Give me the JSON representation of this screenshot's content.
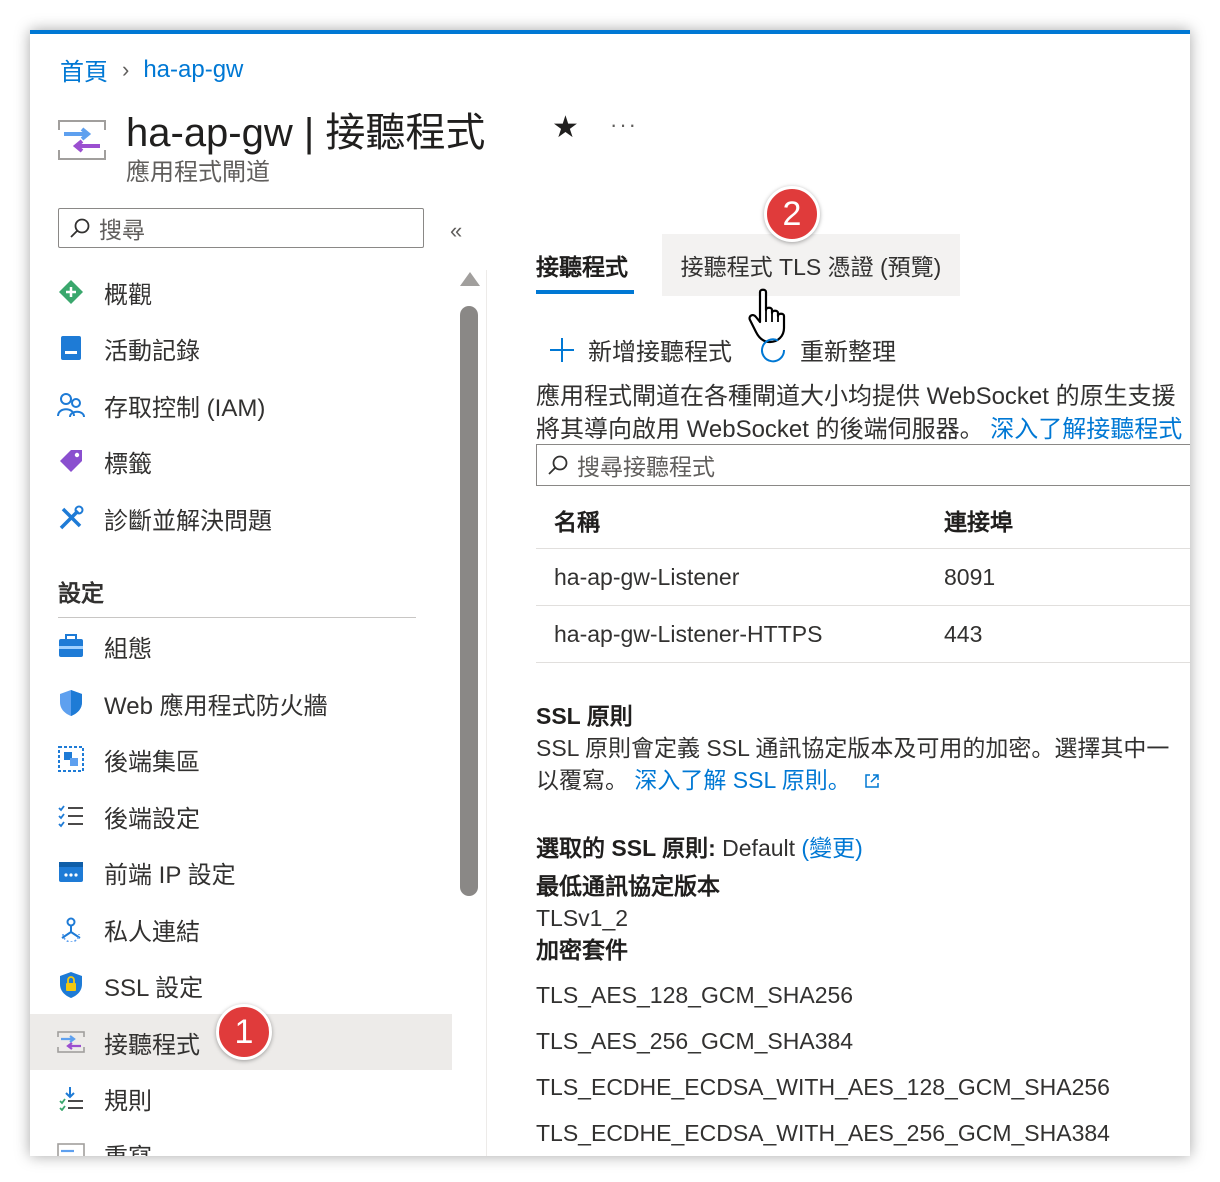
{
  "breadcrumb": {
    "home": "首頁",
    "separator": "›",
    "current": "ha-ap-gw"
  },
  "header": {
    "title": "ha-ap-gw | 接聽程式",
    "subtitle": "應用程式閘道",
    "favorite_glyph": "★",
    "more_glyph": "···",
    "icon": "application-gateway-icon"
  },
  "sidebar": {
    "search_placeholder": "搜尋",
    "collapse_glyph": "«",
    "items": [
      {
        "label": "概觀",
        "icon": "overview-icon"
      },
      {
        "label": "活動記錄",
        "icon": "activity-log-icon"
      },
      {
        "label": "存取控制 (IAM)",
        "icon": "iam-icon"
      },
      {
        "label": "標籤",
        "icon": "tag-icon"
      },
      {
        "label": "診斷並解決問題",
        "icon": "diagnose-icon"
      }
    ],
    "section": "設定",
    "settings_items": [
      {
        "label": "組態",
        "icon": "configuration-icon"
      },
      {
        "label": "Web 應用程式防火牆",
        "icon": "waf-shield-icon"
      },
      {
        "label": "後端集區",
        "icon": "backend-pool-icon"
      },
      {
        "label": "後端設定",
        "icon": "backend-settings-icon"
      },
      {
        "label": "前端 IP 設定",
        "icon": "frontend-ip-icon"
      },
      {
        "label": "私人連結",
        "icon": "private-link-icon"
      },
      {
        "label": "SSL 設定",
        "icon": "ssl-shield-icon"
      },
      {
        "label": "接聽程式",
        "icon": "listener-icon",
        "active": true
      },
      {
        "label": "規則",
        "icon": "rules-icon"
      },
      {
        "label": "重寫",
        "icon": "rewrite-icon"
      }
    ]
  },
  "badges": {
    "one": "1",
    "two": "2"
  },
  "tabs": {
    "listeners": "接聽程式",
    "tls_certs": "接聽程式 TLS 憑證 (預覽)"
  },
  "toolbar": {
    "add": "新增接聽程式",
    "refresh": "重新整理"
  },
  "description": {
    "line1": "應用程式閘道在各種閘道大小均提供 WebSocket 的原生支援",
    "line2": "將其導向啟用 WebSocket 的後端伺服器。",
    "link": "深入了解接聽程式"
  },
  "listener_search_placeholder": "搜尋接聽程式",
  "table": {
    "headers": [
      "名稱",
      "連接埠"
    ],
    "rows": [
      [
        "ha-ap-gw-Listener",
        "8091"
      ],
      [
        "ha-ap-gw-Listener-HTTPS",
        "443"
      ]
    ]
  },
  "ssl": {
    "heading": "SSL 原則",
    "desc_line1": "SSL 原則會定義 SSL 通訊協定版本及可用的加密。選擇其中一",
    "desc_line2": "以覆寫。",
    "learn_more": "深入了解 SSL 原則。",
    "selected_label": "選取的 SSL 原則:",
    "selected_value": "Default",
    "change": "(變更)",
    "min_protocol_label": "最低通訊協定版本",
    "min_protocol_value": "TLSv1_2",
    "ciphers_label": "加密套件",
    "ciphers": [
      "TLS_AES_128_GCM_SHA256",
      "TLS_AES_256_GCM_SHA384",
      "TLS_ECDHE_ECDSA_WITH_AES_128_GCM_SHA256",
      "TLS_ECDHE_ECDSA_WITH_AES_256_GCM_SHA384"
    ]
  },
  "colors": {
    "accent": "#0078d4",
    "badge": "#e03b3b",
    "active_bg": "#edebe9"
  }
}
